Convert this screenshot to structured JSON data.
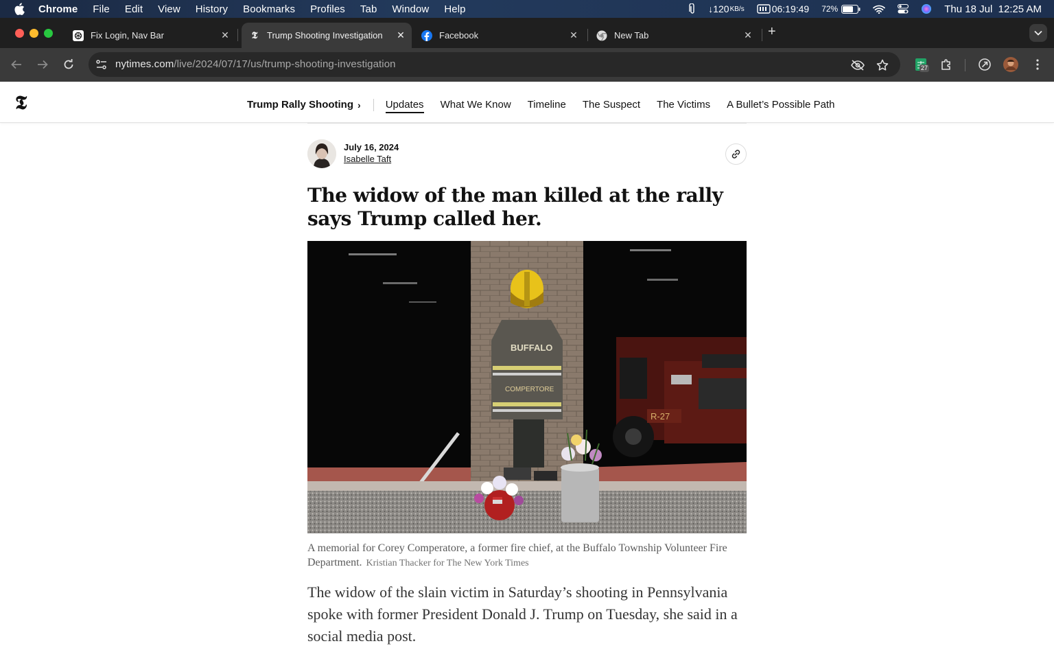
{
  "menubar": {
    "app_name": "Chrome",
    "items": [
      "File",
      "Edit",
      "View",
      "History",
      "Bookmarks",
      "Profiles",
      "Tab",
      "Window",
      "Help"
    ],
    "net_speed": "120",
    "net_unit": "KB/s",
    "timer": "06:19:49",
    "battery": "72%",
    "datetime": "Thu 18 Jul  12:25 AM"
  },
  "tabs": [
    {
      "title": "Fix Login, Nav Bar",
      "icon": "chatgpt-icon"
    },
    {
      "title": "Trump Shooting Investigation",
      "icon": "nyt-icon"
    },
    {
      "title": "Facebook",
      "icon": "facebook-icon"
    },
    {
      "title": "New Tab",
      "icon": "chrome-icon"
    }
  ],
  "toolbar": {
    "url_host": "nytimes.com",
    "url_path": "/live/2024/07/17/us/trump-shooting-investigation",
    "extension_badge": "27"
  },
  "nyt": {
    "logo": "𝕿",
    "section": "Trump Rally Shooting",
    "nav": [
      "Updates",
      "What We Know",
      "Timeline",
      "The Suspect",
      "The Victims",
      "A Bullet’s Possible Path"
    ]
  },
  "article": {
    "date": "July 16, 2024",
    "author": "Isabelle Taft",
    "headline": "The widow of the man killed at the rally says Trump called her.",
    "caption": "A memorial for Corey Comperatore, a former fire chief, at the Buffalo Township Volunteer Fire Department.",
    "credit": "Kristian Thacker for The New York Times",
    "photo_text_jacket": "BUFFALO",
    "photo_text_name": "COMPERTORE",
    "photo_text_truck": "R-27",
    "body": "The widow of the slain victim in Saturday’s shooting in Pennsylvania spoke with former President Donald J. Trump on Tuesday, she said in a social media post."
  },
  "colors": {
    "menubar_bg": "#1d3050",
    "tabstrip_bg": "#1f1f1f",
    "toolbar_bg": "#3a3a3a",
    "facebook_blue": "#1877f2"
  }
}
